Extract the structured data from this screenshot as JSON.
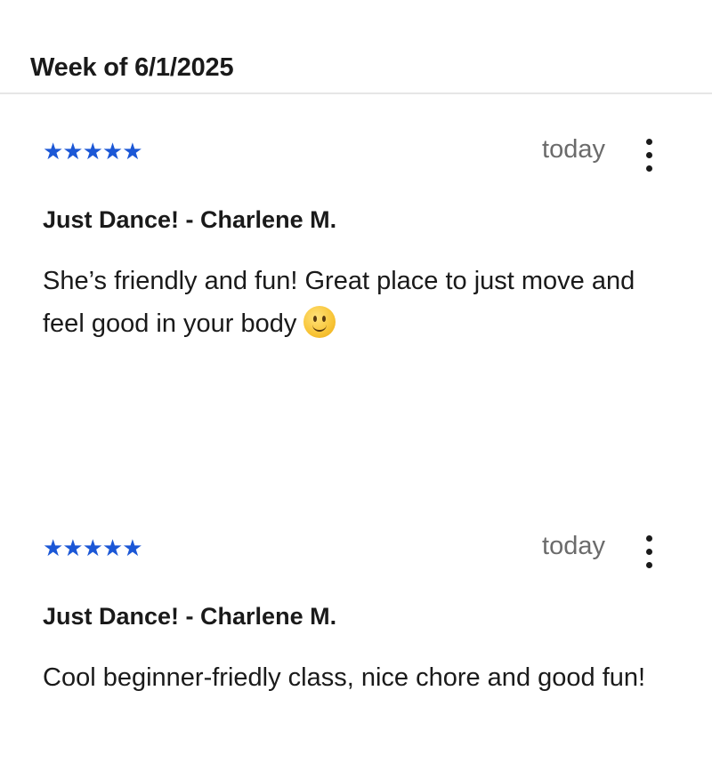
{
  "section": {
    "title": "Week of 6/1/2025"
  },
  "reviews": [
    {
      "stars": "★★★★★",
      "rating": 5,
      "time": "today",
      "title": "Just Dance! - Charlene M.",
      "body": "She’s friendly and fun! Great place to just move and feel good in your body",
      "emoji": "slightly-smiling-face-icon"
    },
    {
      "stars": "★★★★★",
      "rating": 5,
      "time": "today",
      "title": "Just Dance! - Charlene M.",
      "body": "Cool beginner-friedly class, nice chore and good fun!"
    }
  ],
  "colors": {
    "star": "#1b57d6",
    "time": "#6b6b6b",
    "divider": "#e6e6e6"
  }
}
